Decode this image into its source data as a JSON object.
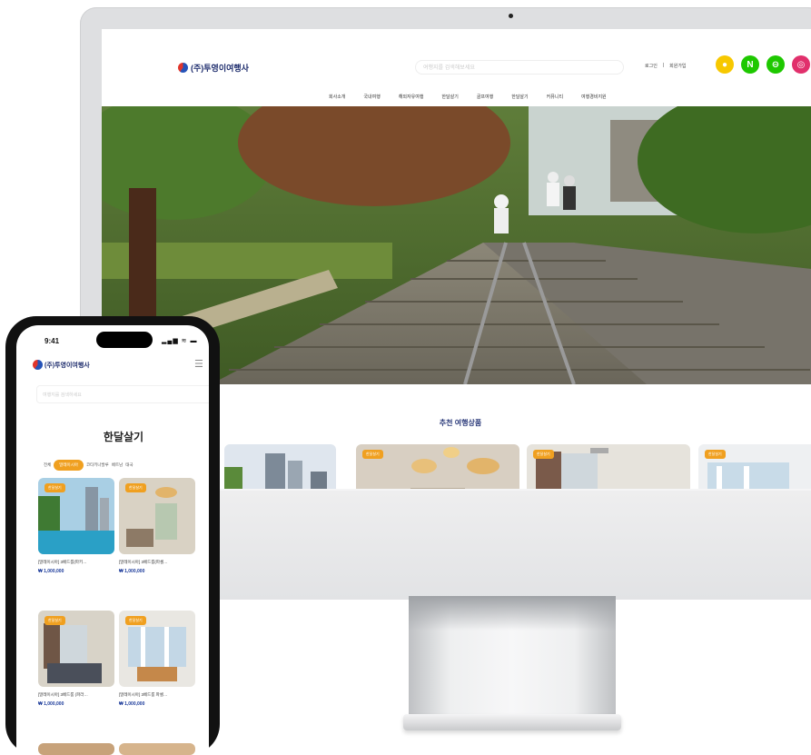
{
  "desktop": {
    "brand": "(주)투영이여행사",
    "search_placeholder": "여행지를 검색해보세요",
    "util_links": [
      "로그인",
      "회원가입"
    ],
    "sns": [
      {
        "name": "kakao",
        "glyph": "●",
        "color": "#f7c800"
      },
      {
        "name": "naver",
        "glyph": "N",
        "color": "#1ec800"
      },
      {
        "name": "band",
        "glyph": "⊖",
        "color": "#1ec800"
      },
      {
        "name": "instagram",
        "glyph": "◎",
        "color": "#e1306c"
      }
    ],
    "nav": [
      "회사소개",
      "국내여행",
      "해외자유여행",
      "한달살기",
      "골프여행",
      "한달살기",
      "커뮤니티",
      "여행경비지원"
    ],
    "section_title": "추천 여행상품",
    "card_badge": "한달살기"
  },
  "mobile": {
    "time": "9:41",
    "status": "▂▄▆ ≋ ▬",
    "brand": "(주)투영이여행사",
    "search_placeholder": "여행지를 검색하세요",
    "title": "한달살기",
    "chips": [
      "전체",
      "말레이시아",
      "코타키나발루",
      "베트남",
      "태국"
    ],
    "badge": "한달살기",
    "items": [
      {
        "name": "[말레이시아] 3베드룸(파키…",
        "price": "₩ 1,000,000"
      },
      {
        "name": "[말레이시아] 3베드룸(파셀…",
        "price": "₩ 1,000,000"
      },
      {
        "name": "[말레이시아] 3베드룸 (파라…",
        "price": "₩ 1,000,000"
      },
      {
        "name": "[말레이시아] 3베드룸 파셀…",
        "price": "₩ 1,000,000"
      }
    ]
  }
}
